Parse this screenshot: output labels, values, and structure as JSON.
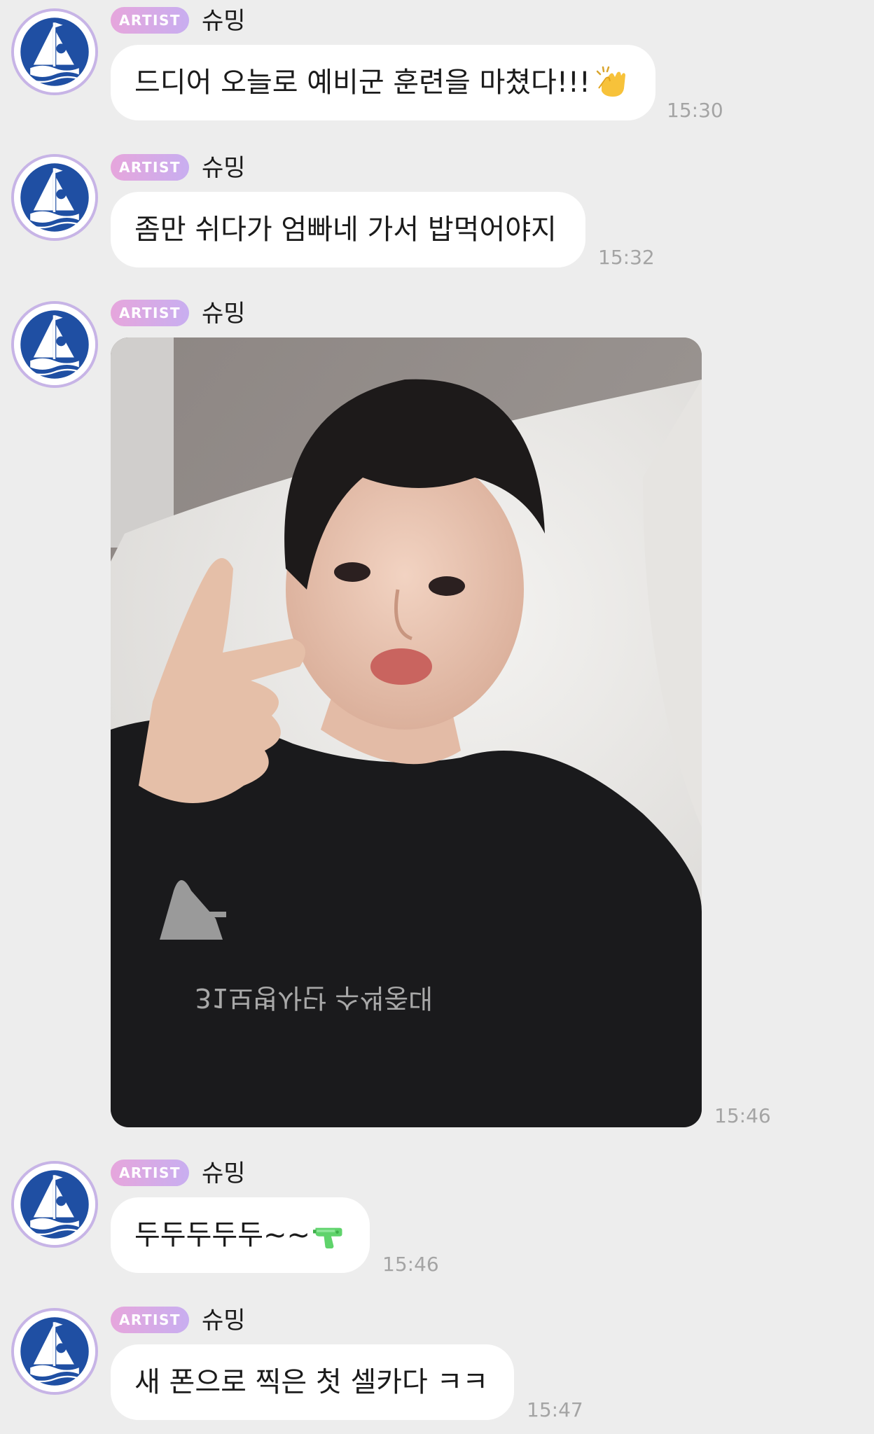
{
  "messages": [
    {
      "badge": "ARTIST",
      "sender": "슈밍",
      "text": "드디어 오늘로 예비군 훈련을 마쳤다!!!",
      "emoji": "clapping-hands-icon",
      "time": "15:30"
    },
    {
      "badge": "ARTIST",
      "sender": "슈밍",
      "text": "좀만 쉬다가 엄빠네 가서 밥먹어야지",
      "time": "15:32"
    },
    {
      "badge": "ARTIST",
      "sender": "슈밍",
      "image": "selfie-photo",
      "shirt_print": "31보병사단 수색중대",
      "time": "15:46"
    },
    {
      "badge": "ARTIST",
      "sender": "슈밍",
      "text": "두두두두두~~",
      "emoji": "water-pistol-icon",
      "time": "15:46"
    },
    {
      "badge": "ARTIST",
      "sender": "슈밍",
      "text": "새 폰으로 찍은 첫 셀카다 ㅋㅋ",
      "time": "15:47"
    }
  ],
  "colors": {
    "background": "#ededed",
    "bubble": "#ffffff",
    "badge_start": "#e6a6dc",
    "badge_end": "#c8aef0",
    "avatar_ring": "#c7b4e6",
    "avatar_blue": "#1f4fa3",
    "time": "#a4a4a4"
  }
}
